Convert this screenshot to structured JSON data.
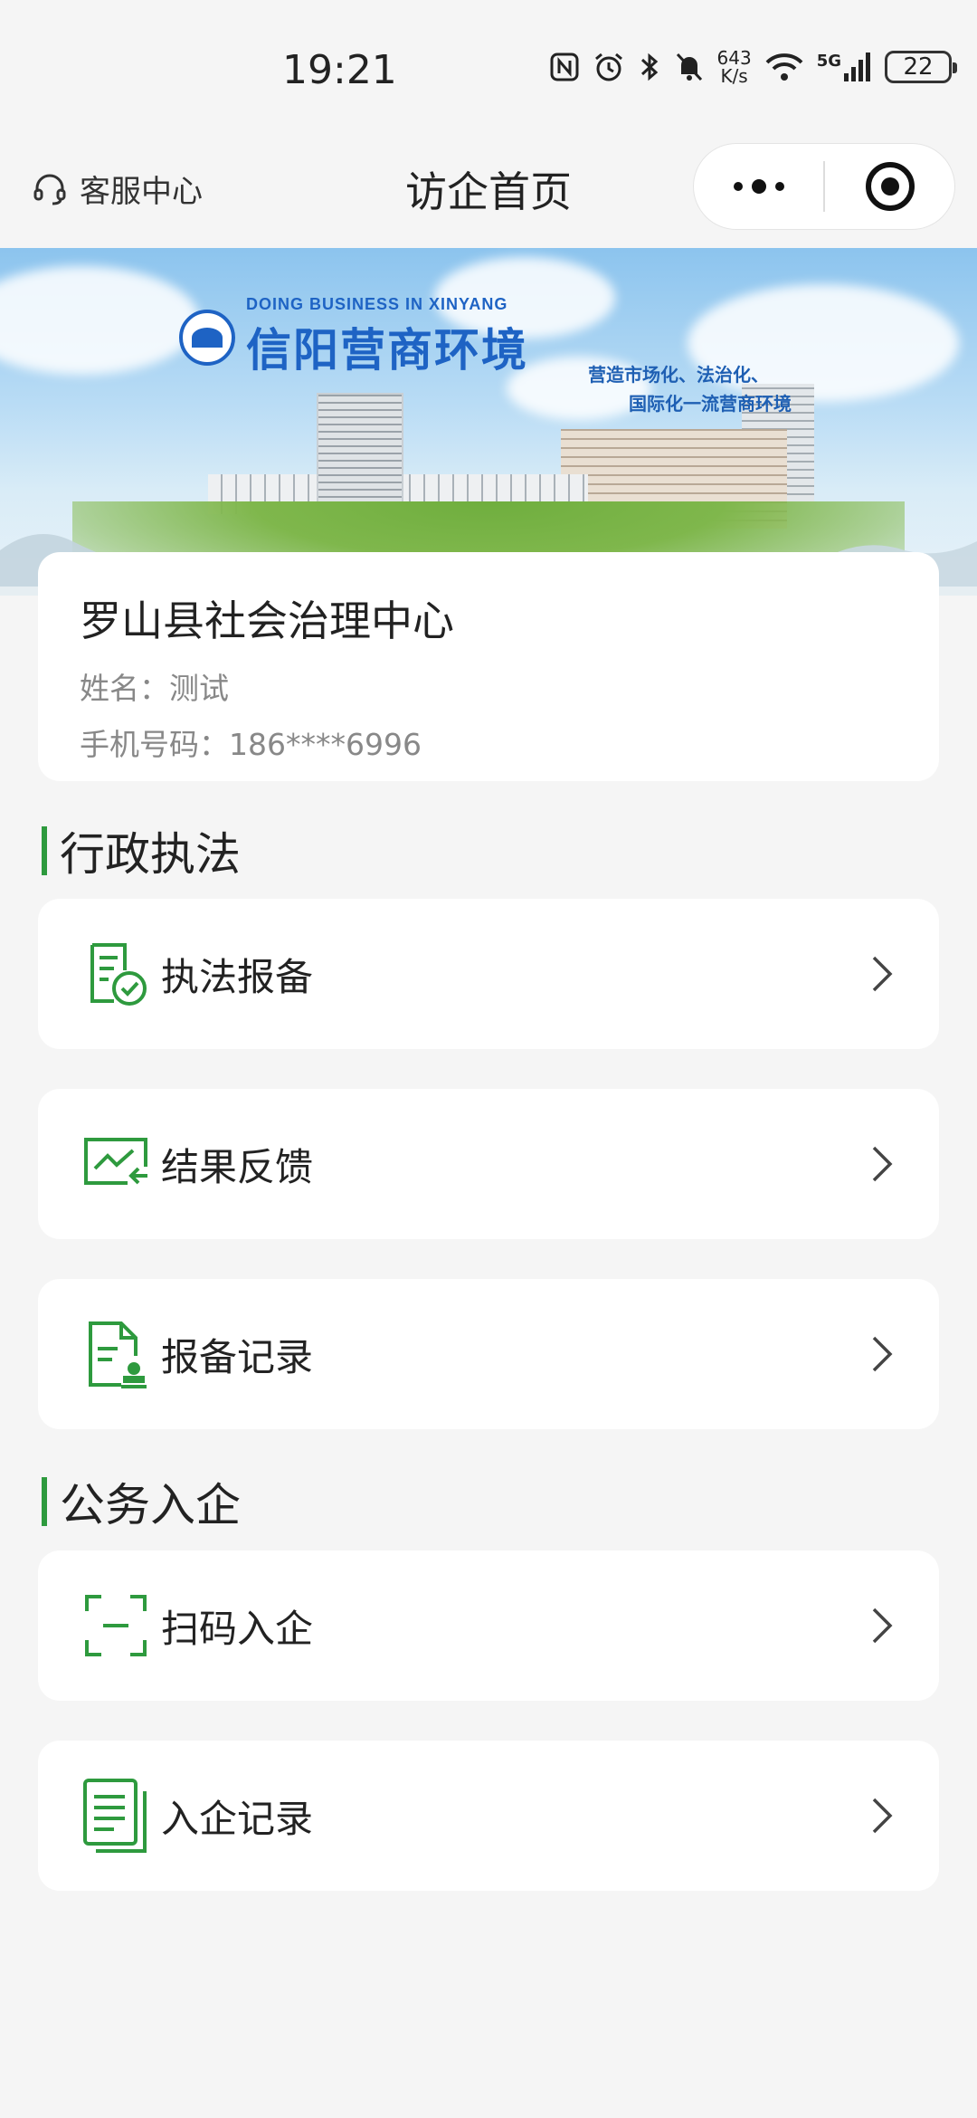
{
  "status_bar": {
    "time": "19:21",
    "net_speed_value": "643",
    "net_speed_unit": "K/s",
    "network": "5G",
    "battery": "22"
  },
  "nav": {
    "service_center": "客服中心",
    "title": "访企首页"
  },
  "banner": {
    "subtitle_en": "DOING BUSINESS IN XINYANG",
    "title": "信阳营商环境",
    "slogan_line1": "营造市场化、法治化、",
    "slogan_line2": "国际化一流营商环境"
  },
  "profile": {
    "org_name": "罗山县社会治理中心",
    "name_line": "姓名：测试",
    "phone_line": "手机号码：186****6996"
  },
  "sections": {
    "law_enforcement": {
      "title": "行政执法",
      "items": [
        {
          "label": "执法报备",
          "icon": "checklist-icon"
        },
        {
          "label": "结果反馈",
          "icon": "chart-feedback-icon"
        },
        {
          "label": "报备记录",
          "icon": "document-stamp-icon"
        }
      ]
    },
    "enterprise_visit": {
      "title": "公务入企",
      "items": [
        {
          "label": "扫码入企",
          "icon": "scan-icon"
        },
        {
          "label": "入企记录",
          "icon": "record-list-icon"
        }
      ]
    }
  },
  "colors": {
    "accent_green": "#2e9a3e",
    "background": "#f5f5f5",
    "banner_blue": "#1e63c4"
  }
}
